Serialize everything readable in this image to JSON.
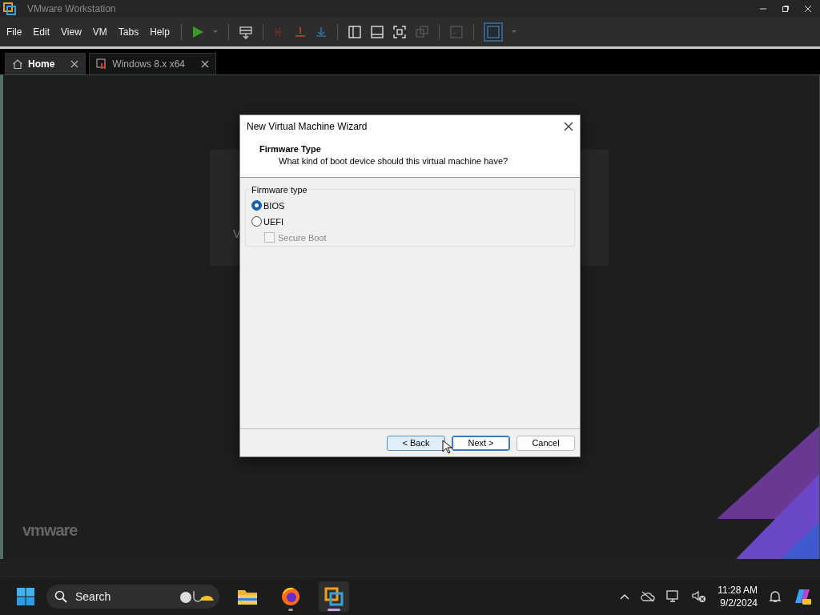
{
  "window": {
    "title": "VMware Workstation"
  },
  "menu": [
    "File",
    "Edit",
    "View",
    "VM",
    "Tabs",
    "Help"
  ],
  "tabs": [
    {
      "label": "Home",
      "selected": true,
      "kind": "home"
    },
    {
      "label": "Windows 8.x x64",
      "selected": false,
      "kind": "vm"
    }
  ],
  "background_card": {
    "text": "V"
  },
  "brand": "vmware",
  "dialog": {
    "title": "New Virtual Machine Wizard",
    "heading": "Firmware Type",
    "subheading": "What kind of boot device should this virtual machine have?",
    "group_label": "Firmware type",
    "options": [
      {
        "label": "BIOS",
        "selected": true
      },
      {
        "label": "UEFI",
        "selected": false
      }
    ],
    "secure_boot": {
      "label": "Secure Boot",
      "checked": false,
      "disabled": true
    },
    "buttons": [
      {
        "label": "< Back",
        "kind": "hover"
      },
      {
        "label": "Next >",
        "kind": "default"
      },
      {
        "label": "Cancel",
        "kind": "normal"
      }
    ]
  },
  "taskbar": {
    "search_placeholder": "Search",
    "time": "11:28 AM",
    "date": "9/2/2024",
    "apps": [
      {
        "kind": "files",
        "running": false,
        "selected": false
      },
      {
        "kind": "firefox",
        "running": true,
        "selected": false
      },
      {
        "kind": "vmware",
        "running": true,
        "selected": true
      }
    ]
  }
}
